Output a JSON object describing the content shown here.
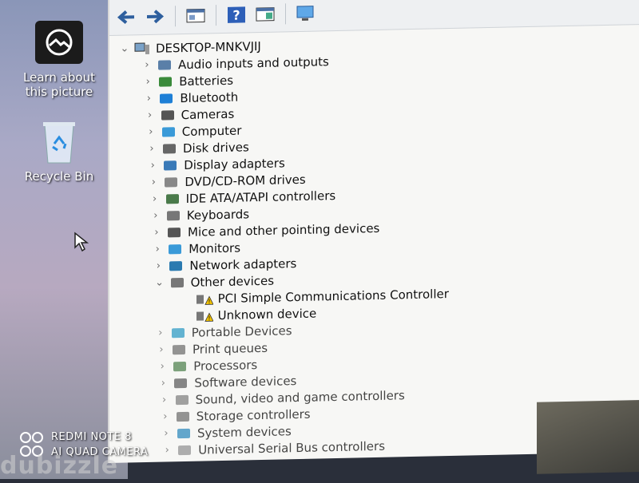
{
  "desktop": {
    "learn_label_line1": "Learn about",
    "learn_label_line2": "this picture",
    "recycle_bin_label": "Recycle Bin"
  },
  "device_manager": {
    "root": "DESKTOP-MNKVJIJ",
    "categories": [
      {
        "label": "Audio inputs and outputs",
        "expanded": false
      },
      {
        "label": "Batteries",
        "expanded": false
      },
      {
        "label": "Bluetooth",
        "expanded": false
      },
      {
        "label": "Cameras",
        "expanded": false
      },
      {
        "label": "Computer",
        "expanded": false
      },
      {
        "label": "Disk drives",
        "expanded": false
      },
      {
        "label": "Display adapters",
        "expanded": false
      },
      {
        "label": "DVD/CD-ROM drives",
        "expanded": false
      },
      {
        "label": "IDE ATA/ATAPI controllers",
        "expanded": false
      },
      {
        "label": "Keyboards",
        "expanded": false
      },
      {
        "label": "Mice and other pointing devices",
        "expanded": false
      },
      {
        "label": "Monitors",
        "expanded": false
      },
      {
        "label": "Network adapters",
        "expanded": false
      },
      {
        "label": "Other devices",
        "expanded": true
      },
      {
        "label": "Portable Devices",
        "expanded": false
      },
      {
        "label": "Print queues",
        "expanded": false
      },
      {
        "label": "Processors",
        "expanded": false
      },
      {
        "label": "Software devices",
        "expanded": false
      },
      {
        "label": "Sound, video and game controllers",
        "expanded": false
      },
      {
        "label": "Storage controllers",
        "expanded": false
      },
      {
        "label": "System devices",
        "expanded": false
      },
      {
        "label": "Universal Serial Bus controllers",
        "expanded": false
      }
    ],
    "other_devices_children": [
      {
        "label": "PCI Simple Communications Controller",
        "status": "warning"
      },
      {
        "label": "Unknown device",
        "status": "warning"
      }
    ]
  },
  "watermark": {
    "line1": "REDMI NOTE 8",
    "line2": "AI QUAD CAMERA",
    "site": "dubizzle"
  },
  "colors": {
    "window_bg": "#f7f7f5",
    "warning": "#f2c200",
    "icon_blue": "#1e7fd6"
  }
}
